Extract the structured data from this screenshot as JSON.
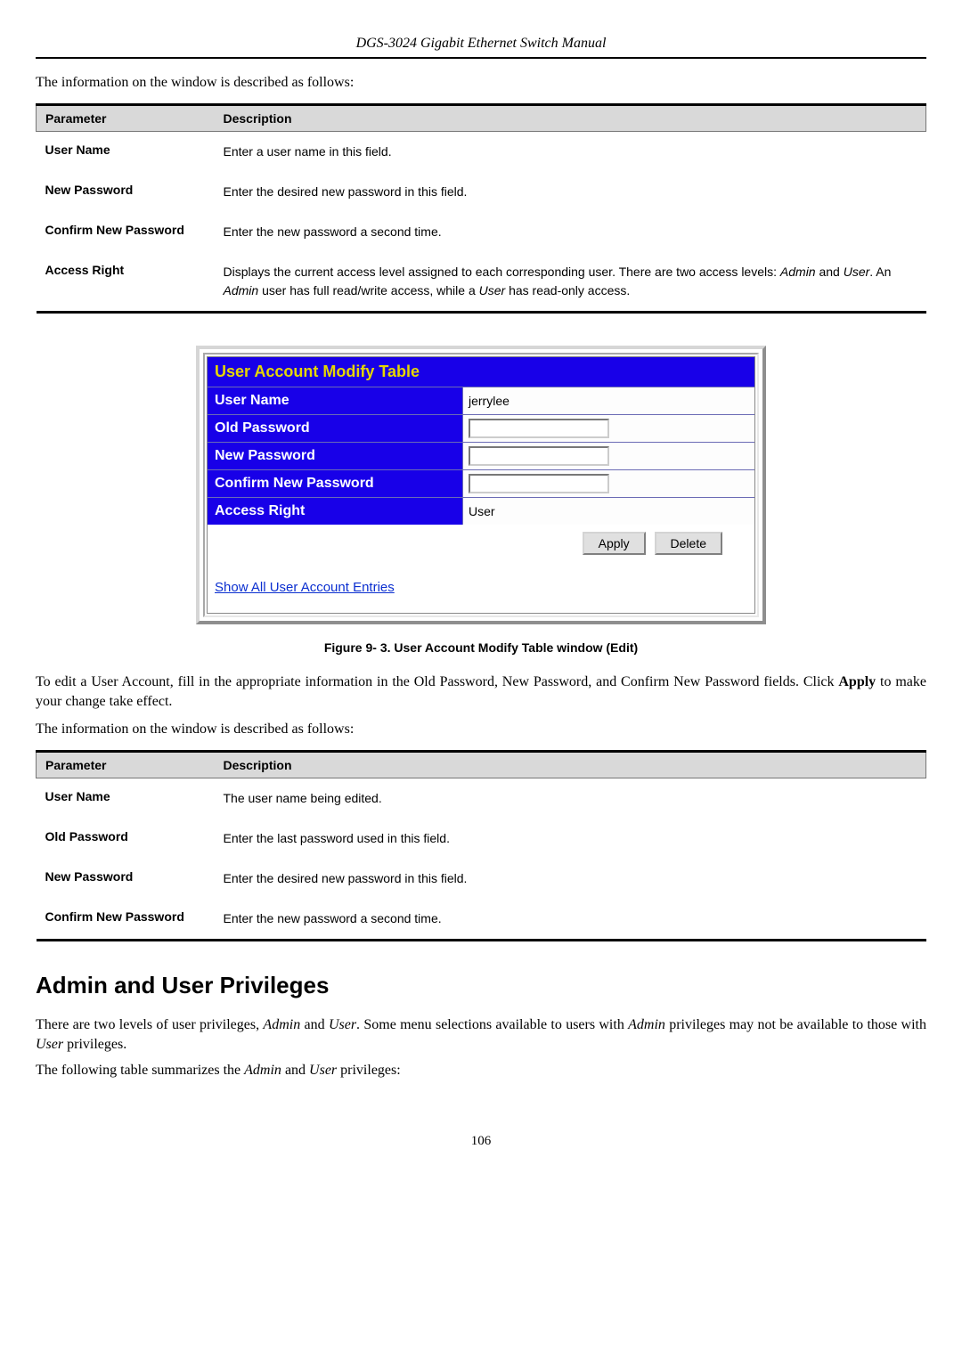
{
  "header": {
    "title": "DGS-3024 Gigabit Ethernet Switch Manual"
  },
  "lead1": "The information on the window is described as follows:",
  "table1": {
    "h_param": "Parameter",
    "h_desc": "Description",
    "rows": [
      {
        "param": "User Name",
        "desc": "Enter a user name in this field."
      },
      {
        "param": "New Password",
        "desc": "Enter the desired new password in this field."
      },
      {
        "param": "Confirm New Password",
        "desc": "Enter the new password a second time."
      },
      {
        "param": "Access Right",
        "desc": "Displays the current access level assigned to each corresponding user. There are two access levels: Admin and User. An Admin user has full read/write access, while a User has read-only access."
      }
    ]
  },
  "ui": {
    "title": "User Account Modify Table",
    "rows": {
      "user_name_label": "User Name",
      "user_name_value": "jerrylee",
      "old_pw_label": "Old Password",
      "new_pw_label": "New Password",
      "confirm_pw_label": "Confirm New Password",
      "access_right_label": "Access Right",
      "access_right_value": "User"
    },
    "buttons": {
      "apply": "Apply",
      "delete": "Delete"
    },
    "footer_link": "Show All User Account Entries"
  },
  "figure_caption": "Figure 9- 3.  User Account Modify Table window (Edit)",
  "body_after_ui_1": "To edit a User Account, fill in the appropriate information in the Old Password, New Password, and Confirm New Password fields. Click ",
  "body_after_ui_strong": "Apply",
  "body_after_ui_2": " to make your change take effect.",
  "lead2": "The information on the window is described as follows:",
  "table2": {
    "h_param": "Parameter",
    "h_desc": "Description",
    "rows": [
      {
        "param": "User Name",
        "desc": "The user name being edited."
      },
      {
        "param": "Old Password",
        "desc": "Enter the last password used in this field."
      },
      {
        "param": "New Password",
        "desc": "Enter the desired new password in this field."
      },
      {
        "param": "Confirm New Password",
        "desc": "Enter the new password a second time."
      }
    ]
  },
  "section_heading": "Admin and User Privileges",
  "priv": {
    "p1_a": "There are two levels of user privileges, ",
    "p1_i1": "Admin",
    "p1_b": " and ",
    "p1_i2": "User",
    "p1_c": ". Some menu selections available to users with ",
    "p1_i3": "Admin",
    "p1_d": " privileges may not be available to those with ",
    "p1_i4": "User",
    "p1_e": " privileges.",
    "p2_a": "The following table summarizes the ",
    "p2_i1": "Admin",
    "p2_b": " and ",
    "p2_i2": "User",
    "p2_c": " privileges:"
  },
  "page_number": "106"
}
